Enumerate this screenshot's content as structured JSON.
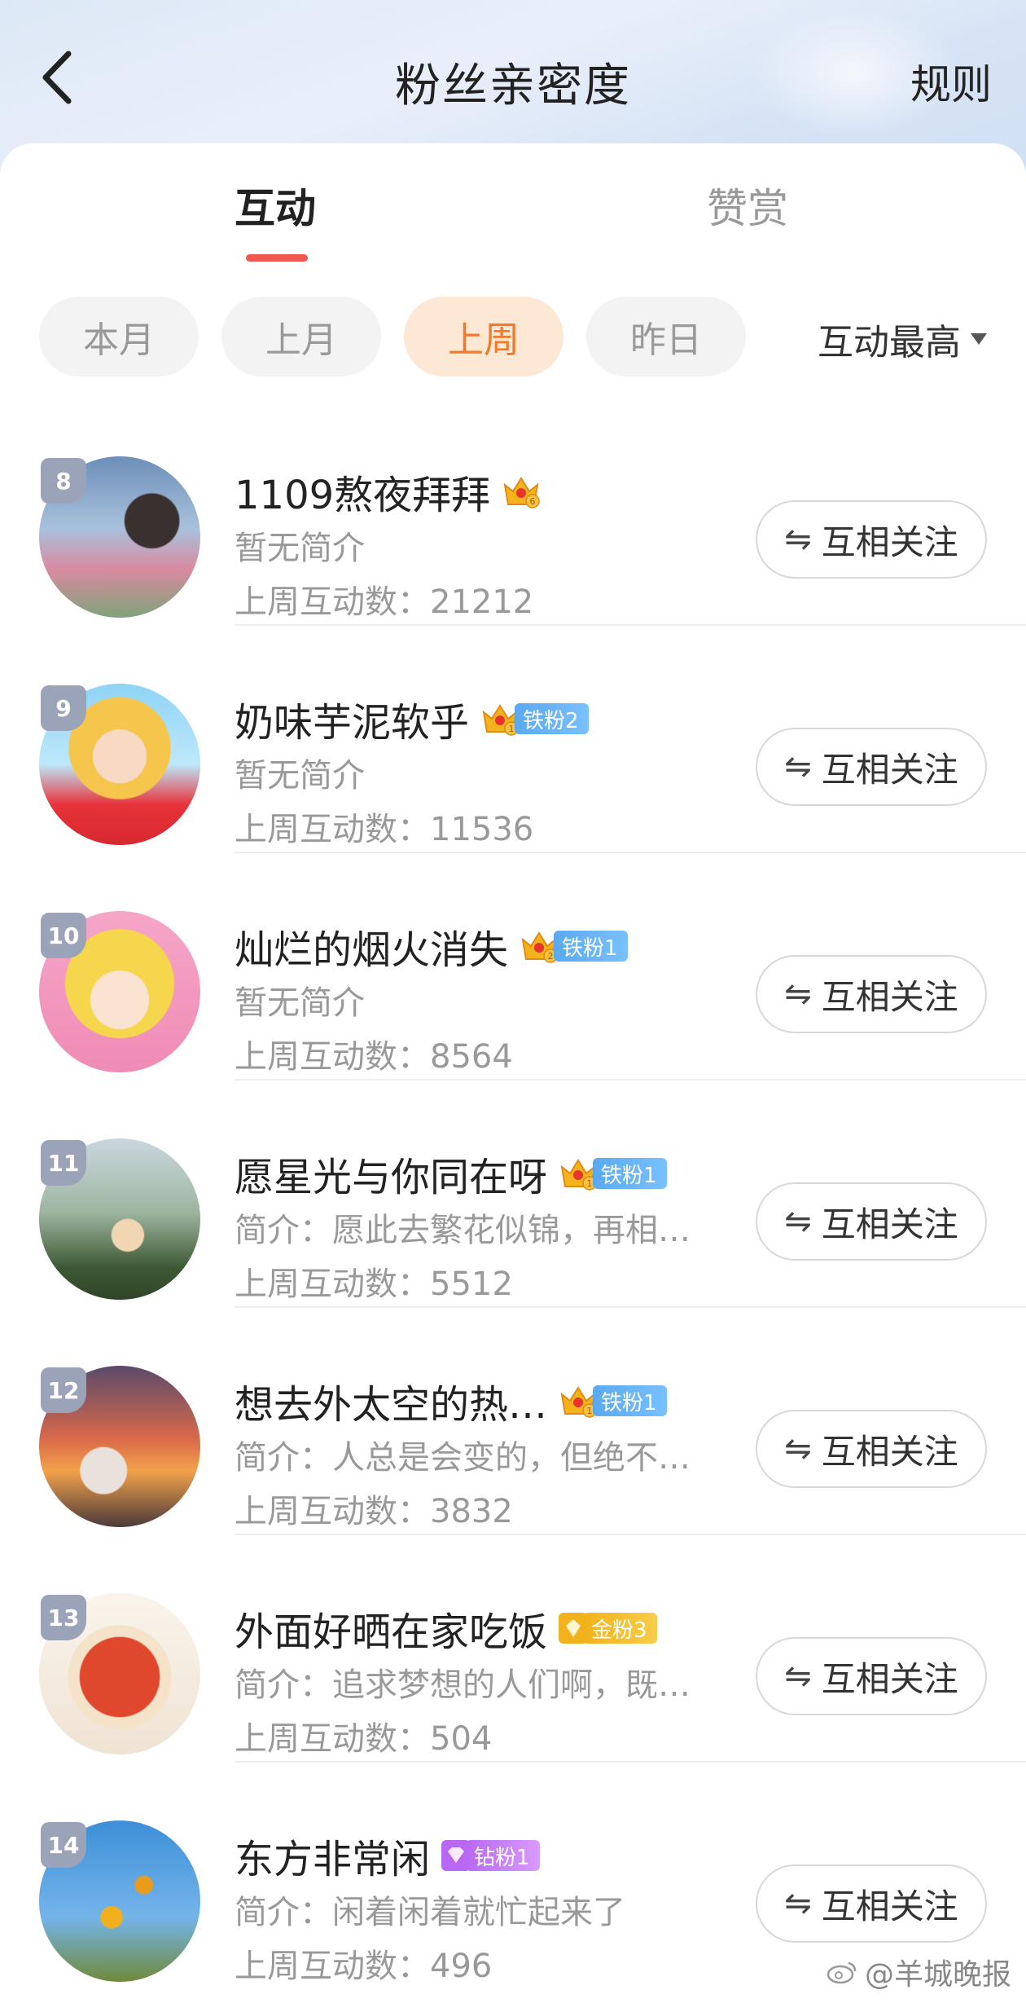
{
  "header": {
    "title": "粉丝亲密度",
    "rules_label": "规则"
  },
  "tabs": [
    {
      "label": "互动",
      "active": true
    },
    {
      "label": "赞赏",
      "active": false
    }
  ],
  "filters": [
    {
      "label": "本月",
      "active": false
    },
    {
      "label": "上月",
      "active": false
    },
    {
      "label": "上周",
      "active": true
    },
    {
      "label": "昨日",
      "active": false
    }
  ],
  "sort_label": "互动最高",
  "follow_label": "互相关注",
  "users": [
    {
      "rank": "8",
      "name": "1109熬夜拜拜",
      "crown_level": "6",
      "fan_tag": "",
      "fan_tag_type": "",
      "bio": "暂无简介",
      "count": "上周互动数：21212"
    },
    {
      "rank": "9",
      "name": "奶味芋泥软乎",
      "crown_level": "1",
      "fan_tag": "铁粉2",
      "fan_tag_type": "iron",
      "bio": "暂无简介",
      "count": "上周互动数：11536"
    },
    {
      "rank": "10",
      "name": "灿烂的烟火消失",
      "crown_level": "2",
      "fan_tag": "铁粉1",
      "fan_tag_type": "iron",
      "bio": "暂无简介",
      "count": "上周互动数：8564"
    },
    {
      "rank": "11",
      "name": "愿星光与你同在呀",
      "crown_level": "1",
      "fan_tag": "铁粉1",
      "fan_tag_type": "iron",
      "bio": "简介：愿此去繁花似锦，再相…",
      "count": "上周互动数：5512"
    },
    {
      "rank": "12",
      "name": "想去外太空的热…",
      "crown_level": "1",
      "fan_tag": "铁粉1",
      "fan_tag_type": "iron",
      "bio": "简介：人总是会变的，但绝不…",
      "count": "上周互动数：3832"
    },
    {
      "rank": "13",
      "name": "外面好晒在家吃饭",
      "crown_level": "",
      "fan_tag": "金粉3",
      "fan_tag_type": "gold",
      "bio": "简介：追求梦想的人们啊，既…",
      "count": "上周互动数：504"
    },
    {
      "rank": "14",
      "name": "东方非常闲",
      "crown_level": "",
      "fan_tag": "钻粉1",
      "fan_tag_type": "diamond",
      "bio": "简介：闲着闲着就忙起来了",
      "count": "上周互动数：496"
    }
  ],
  "watermark": "@羊城晚报",
  "colors": {
    "accent_underline": "#f0584f",
    "active_chip_bg": "#fde8d6",
    "active_chip_text": "#f07a2a",
    "iron_tag": "#5aa9f0",
    "gold_tag": "#f2b21b",
    "diamond_tag": "#b868f2"
  }
}
